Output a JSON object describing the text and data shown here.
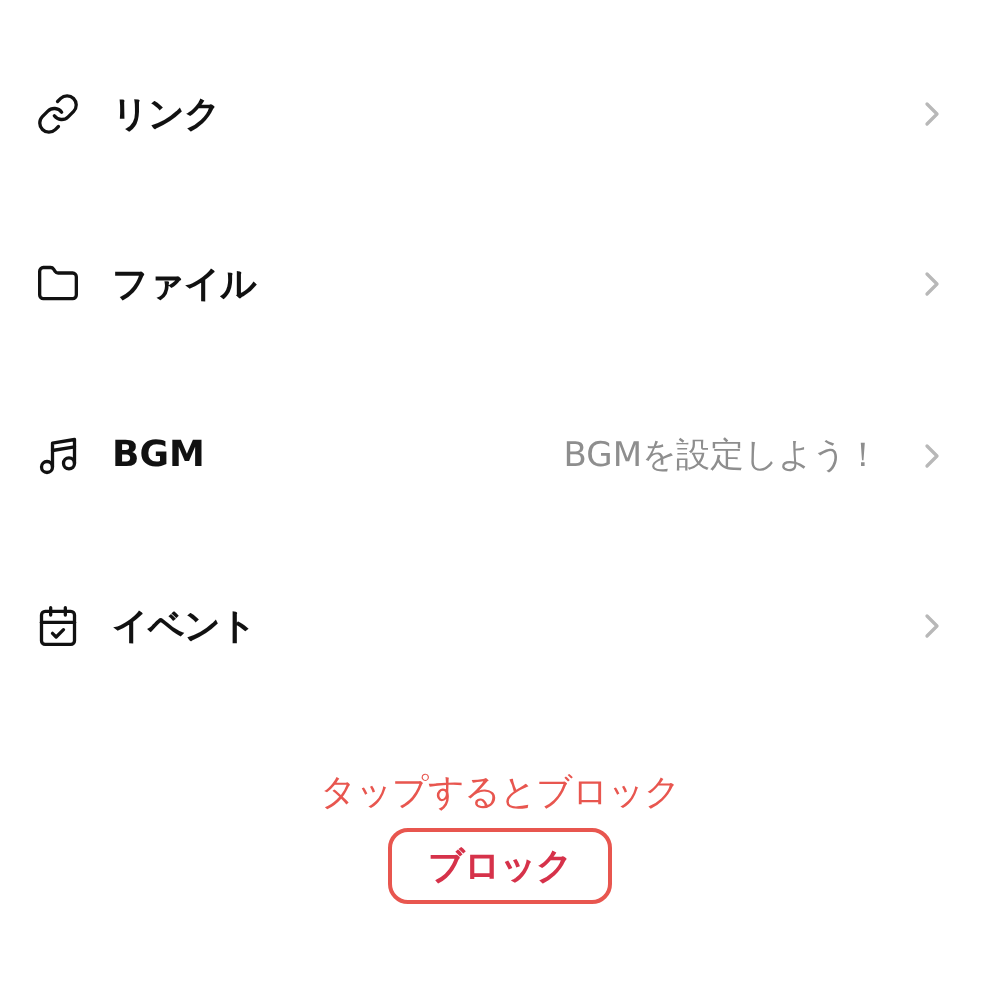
{
  "menu_items": [
    {
      "kind": "link",
      "label": "リンク"
    },
    {
      "kind": "folder",
      "label": "ファイル"
    },
    {
      "kind": "music",
      "label": "BGM",
      "hint": "BGMを設定しよう！"
    },
    {
      "kind": "calendar",
      "label": "イベント"
    }
  ],
  "block": {
    "hint": "タップするとブロック",
    "button": "ブロック"
  }
}
